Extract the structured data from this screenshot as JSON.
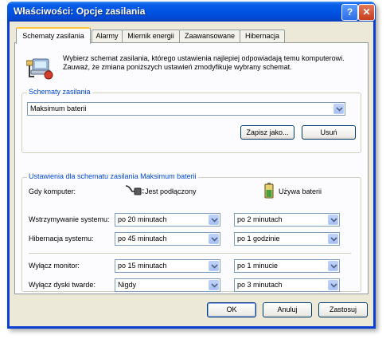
{
  "window": {
    "title": "Właściwości: Opcje zasilania",
    "help_glyph": "?",
    "close_glyph": "✕"
  },
  "tabs": [
    {
      "label": "Schematy zasilania",
      "active": true
    },
    {
      "label": "Alarmy",
      "active": false
    },
    {
      "label": "Miernik energii",
      "active": false
    },
    {
      "label": "Zaawansowane",
      "active": false
    },
    {
      "label": "Hibernacja",
      "active": false
    }
  ],
  "intro": {
    "line1": "Wybierz schemat zasilania, którego ustawienia najlepiej odpowiadają temu komputerowi.",
    "line2": "Zauważ, że zmiana poniższych ustawień zmodyfikuje wybrany schemat.",
    "icon": "power-options-icon"
  },
  "schemes": {
    "group_label": "Schematy zasilania",
    "selected": "Maksimum baterii",
    "save_as_label": "Zapisz jako...",
    "delete_label": "Usuń"
  },
  "settings": {
    "group_label": "Ustawienia dla schematu zasilania Maksimum baterii",
    "when_label": "Gdy komputer:",
    "plugged_label": "Jest podłączony",
    "battery_label": "Używa baterii",
    "rows": [
      {
        "label": "Wstrzymywanie systemu:",
        "plugged": "po 20 minutach",
        "battery": "po 2 minutach"
      },
      {
        "label": "Hibernacja systemu:",
        "plugged": "po 45 minutach",
        "battery": "po 1 godzinie"
      },
      {
        "label": "Wyłącz monitor:",
        "plugged": "po 15 minutach",
        "battery": "po 1 minucie"
      },
      {
        "label": "Wyłącz dyski twarde:",
        "plugged": "Nigdy",
        "battery": "po 3 minutach"
      }
    ]
  },
  "footer": {
    "ok_label": "OK",
    "cancel_label": "Anuluj",
    "apply_label": "Zastosuj"
  },
  "colors": {
    "title_bar": "#0054e3",
    "dialog_bg": "#ece9d8",
    "group_label": "#0046d5",
    "active_tab_accent": "#ffc83c"
  }
}
